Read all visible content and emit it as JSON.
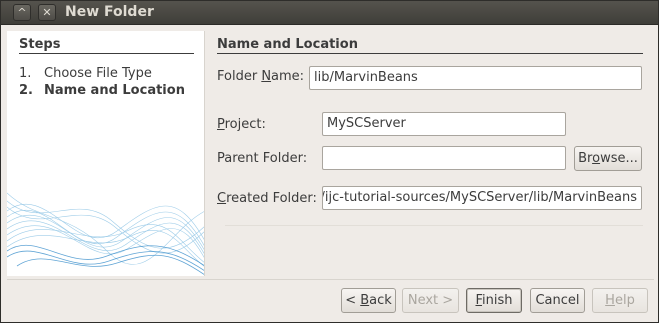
{
  "window": {
    "title": "New Folder",
    "controls": {
      "collapse": "^",
      "close": "✕"
    }
  },
  "steps": {
    "heading": "Steps",
    "items": [
      {
        "num": "1.",
        "label": "Choose File Type"
      },
      {
        "num": "2.",
        "label": "Name and Location"
      }
    ]
  },
  "panel": {
    "heading": "Name and Location",
    "folder_name": {
      "label_pre": "Folder ",
      "label_mnemonic": "N",
      "label_post": "ame:",
      "value": "lib/MarvinBeans"
    },
    "project": {
      "label_pre": "",
      "label_mnemonic": "P",
      "label_post": "roject:",
      "value": "MySCServer"
    },
    "parent_folder": {
      "label": "Parent Folder:",
      "value": ""
    },
    "browse_button": {
      "pre": "Br",
      "mnemonic": "o",
      "post": "wse..."
    },
    "created_folder": {
      "label_pre": "",
      "label_mnemonic": "C",
      "label_post": "reated Folder:",
      "value": "s/ijc-tutorial-sources/MySCServer/lib/MarvinBeans"
    }
  },
  "buttons": {
    "back": {
      "pre": "< ",
      "mnemonic": "B",
      "post": "ack"
    },
    "next": {
      "label": "Next >"
    },
    "finish": {
      "pre": "",
      "mnemonic": "F",
      "post": "inish"
    },
    "cancel": {
      "label": "Cancel"
    },
    "help": {
      "pre": "",
      "mnemonic": "H",
      "post": "elp"
    }
  },
  "colors": {
    "titlebar": "#3f3e39",
    "dialog_bg": "#efebe7",
    "wave_blue": "#4fa3d6"
  }
}
